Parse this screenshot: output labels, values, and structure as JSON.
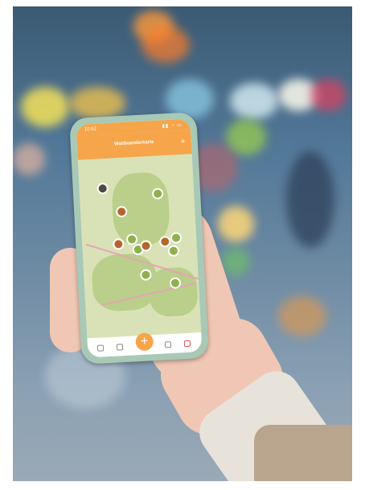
{
  "phone_app": {
    "status_time": "10:52",
    "status_icons": "▮▮ ◔ ▭",
    "title": "Waldwanderkarte",
    "menu_glyph": "≡",
    "fab_glyph": "+"
  },
  "colors": {
    "accent": "#f6a54a",
    "pin_green": "#8fb04c",
    "pin_brown": "#b5662e",
    "map_base": "#d9e2b6"
  }
}
